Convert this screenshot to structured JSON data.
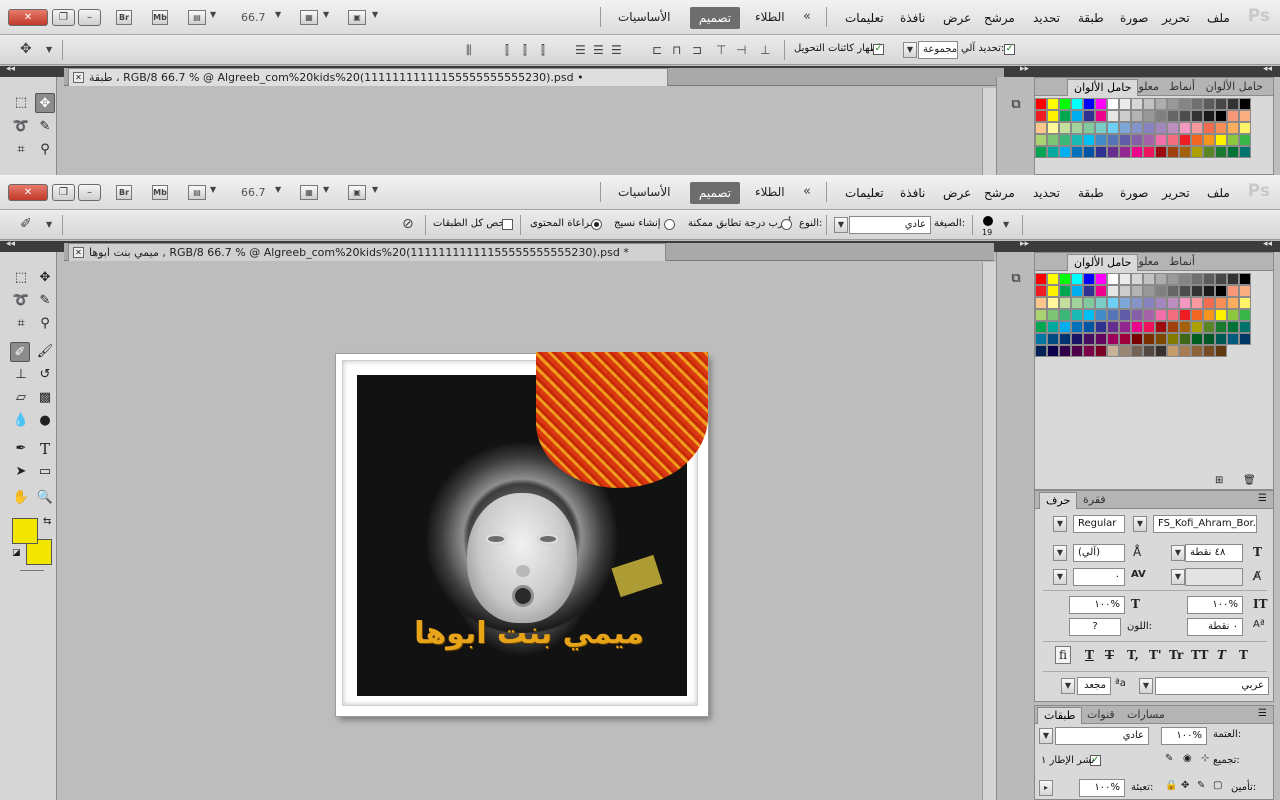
{
  "windows": [
    {
      "menubar": {
        "zoom": "66.7",
        "menus": [
          "ملف",
          "تحرير",
          "صورة",
          "طبقة",
          "تحديد",
          "مرشح",
          "عرض",
          "نافذة",
          "تعليمات"
        ],
        "painting": "الطلاء",
        "design": "تصميم",
        "essentials": "الأساسيات",
        "app_icon": "Ps",
        "bridge": "Br",
        "minibridge": "Mb"
      },
      "options": {
        "auto_select_label": "تحديد آلي:",
        "group_value": "مجموعة",
        "show_transform_label": "إظهار كائنات التحويل"
      },
      "doc_tab": "طبقة ، RGB/8 66.7 % @ Algreeb_com%20kids%20(11111111111155555555555230).psd •"
    },
    {
      "menubar": {
        "zoom": "66.7",
        "menus": [
          "ملف",
          "تحرير",
          "صورة",
          "طبقة",
          "تحديد",
          "مرشح",
          "عرض",
          "نافذة",
          "تعليمات"
        ],
        "painting": "الطلاء",
        "design": "تصميم",
        "essentials": "الأساسيات",
        "app_icon": "Ps",
        "bridge": "Br",
        "minibridge": "Mb"
      },
      "options": {
        "brush_size": "19",
        "mode_label": "الصيغة:",
        "mode_value": "عادي",
        "type_label": "النوع:",
        "proximity_label": "أقرب درجة تطابق ممكنة",
        "texture_label": "إنشاء نسيج",
        "content_label": "مراعاة المحتوى",
        "sample_all_label": "فحص كل الطبقات"
      },
      "doc_tab": "ميمي بنت ابوها , RGB/8 66.7 % @ Algreeb_com%20kids%20(11111111111155555555555230).psd *"
    }
  ],
  "canvas": {
    "caption": "ميمي بنت ابوها"
  },
  "swatch_panel": {
    "tabs": [
      "حامل الألوان",
      "أنماط",
      "معلومات"
    ],
    "colors": [
      "#ff0000",
      "#ffff00",
      "#00ff00",
      "#00ffff",
      "#0000ff",
      "#ff00ff",
      "#ffffff",
      "#ebebeb",
      "#d6d6d6",
      "#c2c2c2",
      "#adadad",
      "#999999",
      "#858585",
      "#707070",
      "#5c5c5c",
      "#474747",
      "#333333",
      "#000000",
      "#ee1d24",
      "#fff200",
      "#00a650",
      "#00aeef",
      "#2e3192",
      "#ec008c",
      "#e6e6e6",
      "#cccccc",
      "#b3b3b3",
      "#999999",
      "#808080",
      "#666666",
      "#4d4d4d",
      "#333333",
      "#1a1a1a",
      "#000000",
      "#f7977a",
      "#f9ad81",
      "#fdc68a",
      "#fff79a",
      "#c4df9b",
      "#a3d39c",
      "#82ca9d",
      "#7bcdc8",
      "#6ecff6",
      "#7ea7d8",
      "#8493ca",
      "#8882be",
      "#a187be",
      "#bc8dbf",
      "#f49ac2",
      "#f6989d",
      "#f26c4f",
      "#f68e55",
      "#fbaf5c",
      "#fff467",
      "#acd372",
      "#7cc576",
      "#3bb878",
      "#1abbb4",
      "#00bff3",
      "#438cca",
      "#5574b9",
      "#605ca8",
      "#855fa8",
      "#a763a8",
      "#f06ea9",
      "#f26d7d",
      "#ed1c24",
      "#f26522",
      "#f7941d",
      "#fff200",
      "#8dc63f",
      "#39b54a",
      "#00a651",
      "#00a99d",
      "#00aeef",
      "#0072bc",
      "#0054a6",
      "#2e3192",
      "#662d91",
      "#92278f",
      "#ec008c",
      "#ed145b",
      "#9e0b0f",
      "#a0410d",
      "#a3620a",
      "#aba000",
      "#598527",
      "#1a7b30",
      "#007236",
      "#00746b",
      "#0076a3",
      "#004b80",
      "#003471",
      "#1b1464",
      "#440e62",
      "#630460",
      "#9e005d",
      "#9e0039",
      "#790000",
      "#7b2e00",
      "#7d4900",
      "#827b00",
      "#406618",
      "#005e20",
      "#005826",
      "#005952",
      "#005b7f",
      "#003663",
      "#002157",
      "#0d004c",
      "#32004b",
      "#4b0049",
      "#7b0046",
      "#7a0026",
      "#c7b299",
      "#998675",
      "#736357",
      "#534741",
      "#37302d",
      "#c69c6d",
      "#a67c52",
      "#8c6239",
      "#754c24",
      "#603913"
    ]
  },
  "char_panel": {
    "tabs": [
      "حرف",
      "فقرة"
    ],
    "font_family": "FS_Kofi_Ahram_Bor...",
    "font_style": "Regular",
    "size": "٤٨ نقطة",
    "leading": "(آلي)",
    "tracking": "٠",
    "vscale": "١٠٠%",
    "hscale": "١٠٠%",
    "baseline": "٠ نقطة",
    "color_label": "اللون:",
    "color_value": "?",
    "language": "عربي",
    "aa_mode": "مجعد",
    "style_buttons": [
      "T",
      "T",
      "TT",
      "Tr",
      "T'",
      "T,",
      "T",
      "T",
      "fi"
    ]
  },
  "layers_panel": {
    "tabs": [
      "طبقات",
      "قنوات",
      "مسارات"
    ],
    "blend": "عادي",
    "opacity_label": "العتمة:",
    "opacity": "١٠٠%",
    "unify_label": "تجميع:",
    "propagate_label": "نشر الإطار ١",
    "lock_label": "تأمين:",
    "fill_label": "تعبئة:",
    "fill": "١٠٠%"
  },
  "colors": {
    "foreground": "#f2e600",
    "background": "#f2e600",
    "accent": "#6d6d6d",
    "caption": "#e8a418"
  }
}
